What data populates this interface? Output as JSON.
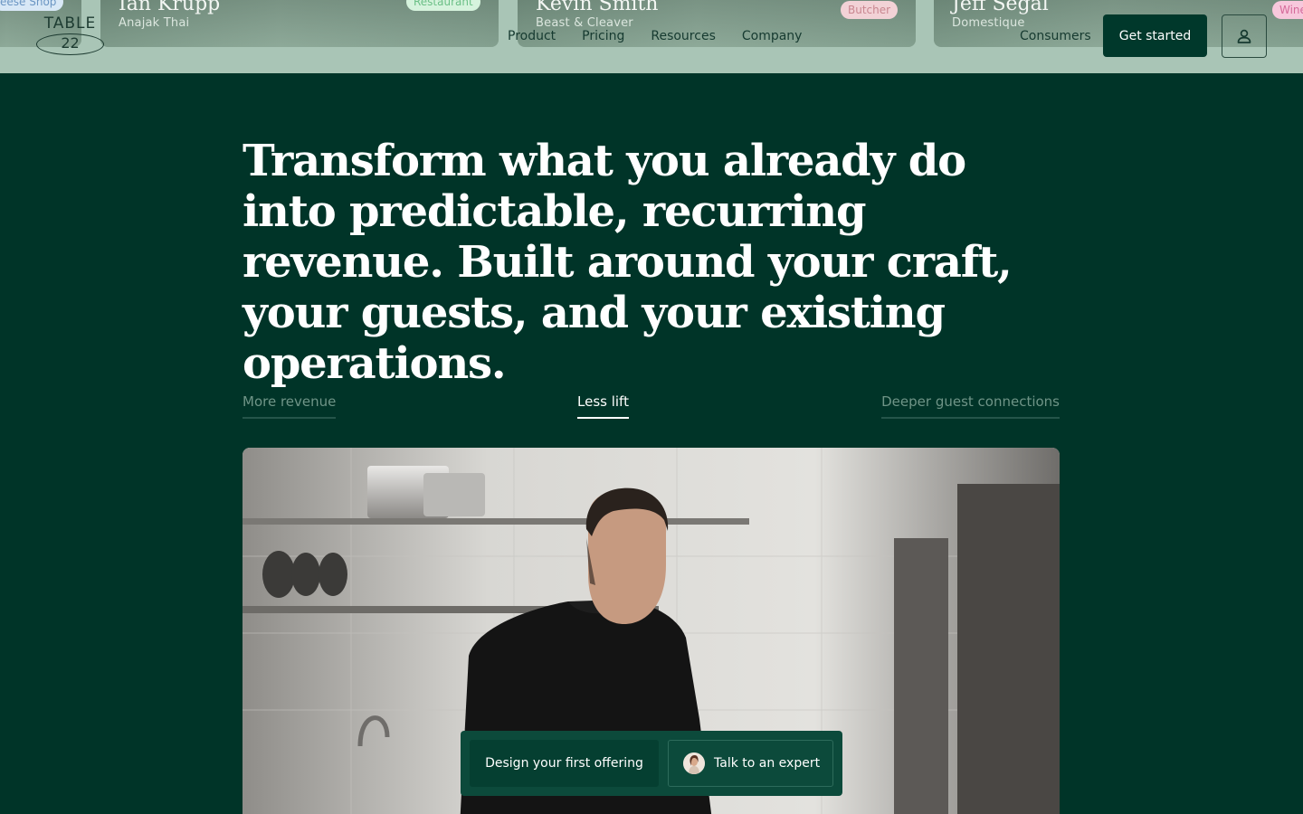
{
  "header": {
    "logo": {
      "top": "TABLE",
      "number": "22"
    },
    "nav": [
      "Product",
      "Pricing",
      "Resources",
      "Company"
    ],
    "consumers_link": "Consumers",
    "get_started": "Get started",
    "user_icon": "user-icon"
  },
  "cards": [
    {
      "name": "",
      "sub": "",
      "tag": "eese Shop"
    },
    {
      "name": "Ian Krupp",
      "sub": "Anajak Thai",
      "tag": "Restaurant"
    },
    {
      "name": "Kevin Smith",
      "sub": "Beast & Cleaver",
      "tag": "Butcher"
    },
    {
      "name": "Jeff Segal",
      "sub": "Domestique",
      "tag": "Wine"
    }
  ],
  "hero": {
    "headline": "Transform what you already do into predictable, recurring revenue. Built around your craft, your guests, and your existing operations."
  },
  "tabs": [
    {
      "label": "More revenue",
      "active": false
    },
    {
      "label": "Less lift",
      "active": true
    },
    {
      "label": "Deeper guest connections",
      "active": false
    }
  ],
  "cta": {
    "primary": "Design your first offering",
    "secondary": "Talk to an expert"
  },
  "colors": {
    "background": "#003428",
    "header_strip": "#a9c5b6",
    "button_dark": "#00382b"
  }
}
